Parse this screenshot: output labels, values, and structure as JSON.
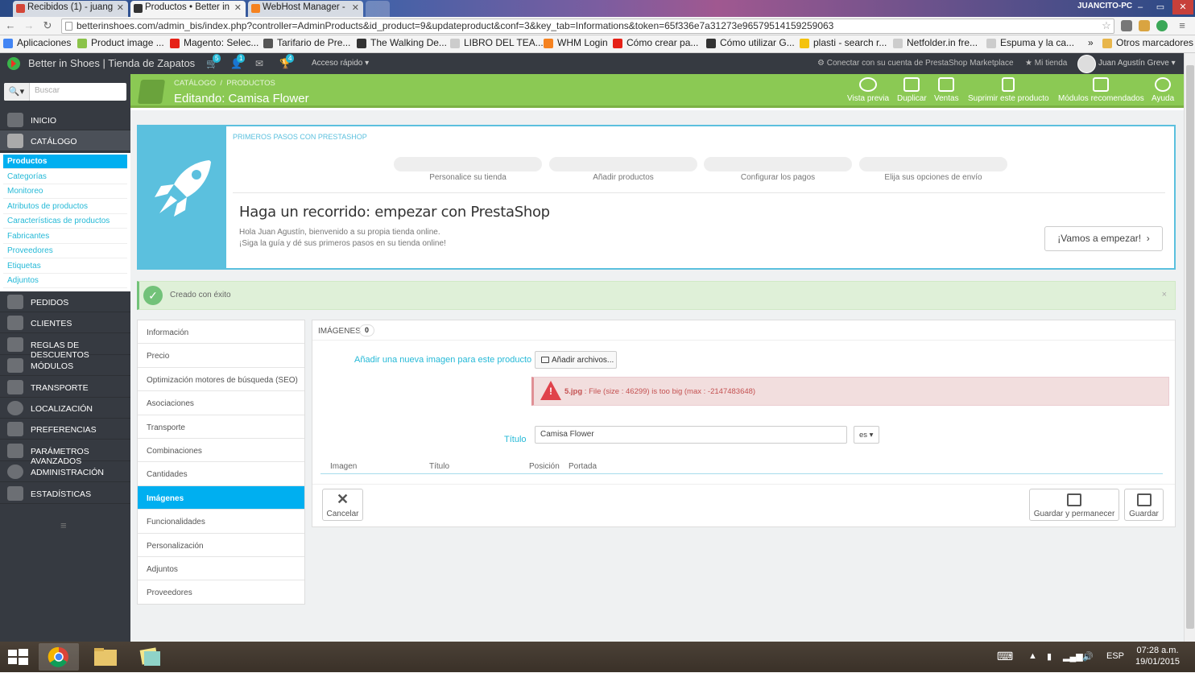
{
  "browser": {
    "tabs": [
      {
        "title": "Recibidos (1) - juang",
        "color": "#d44638"
      },
      {
        "title": "Productos • Better in",
        "color": "#333333"
      },
      {
        "title": "WebHost Manager -",
        "color": "#f58220"
      }
    ],
    "computer_name": "JUANCITO-PC",
    "url": "betterinshoes.com/admin_bis/index.php?controller=AdminProducts&id_product=9&updateproduct&conf=3&key_tab=Informations&token=65f336e7a31273e96579514159259063",
    "bookmarks": [
      {
        "label": "Aplicaciones",
        "color": "#4285f4"
      },
      {
        "label": "Product image ...",
        "color": "#8bc34a"
      },
      {
        "label": "Magento: Selec...",
        "color": "#e62117"
      },
      {
        "label": "Tarifario de Pre...",
        "color": "#555555"
      },
      {
        "label": "The Walking De...",
        "color": "#333333"
      },
      {
        "label": "LIBRO DEL TEA...",
        "color": "#cccccc"
      },
      {
        "label": "WHM Login",
        "color": "#f58220"
      },
      {
        "label": "Cómo crear pa...",
        "color": "#e62117"
      },
      {
        "label": "Cómo utilizar G...",
        "color": "#333333"
      },
      {
        "label": "plasti - search r...",
        "color": "#f4c20d"
      },
      {
        "label": "Netfolder.in fre...",
        "color": "#cccccc"
      },
      {
        "label": "Espuma y la ca...",
        "color": "#cccccc"
      },
      {
        "label": "»",
        "color": ""
      },
      {
        "label": "Otros marcadores",
        "color": "#e8b64c"
      }
    ]
  },
  "header": {
    "shop_name": "Better in Shoes | Tienda de Zapatos",
    "badges": {
      "orders": "5",
      "customers": "1",
      "trophies": "4"
    },
    "quick_access": "Acceso rápido",
    "connect": "Conectar con su cuenta de PrestaShop Marketplace",
    "my_shop": "Mi tienda",
    "user": "Juan Agustín Greve"
  },
  "sidebar": {
    "search_placeholder": "Buscar",
    "items": [
      {
        "label": "INICIO",
        "icon": "dashboard-icon"
      },
      {
        "label": "CATÁLOGO",
        "icon": "book-icon"
      },
      {
        "label": "PEDIDOS",
        "icon": "credit-card-icon"
      },
      {
        "label": "CLIENTES",
        "icon": "users-icon"
      },
      {
        "label": "REGLAS DE DESCUENTOS",
        "icon": "tags-icon"
      },
      {
        "label": "MÓDULOS",
        "icon": "puzzle-icon"
      },
      {
        "label": "TRANSPORTE",
        "icon": "truck-icon"
      },
      {
        "label": "LOCALIZACIÓN",
        "icon": "globe-icon"
      },
      {
        "label": "PREFERENCIAS",
        "icon": "wrench-icon"
      },
      {
        "label": "PARÁMETROS AVANZADOS",
        "icon": "cogs-icon"
      },
      {
        "label": "ADMINISTRACIÓN",
        "icon": "cog-icon"
      },
      {
        "label": "ESTADÍSTICAS",
        "icon": "bar-chart-icon"
      }
    ],
    "catalog_sub": [
      "Productos",
      "Categorías",
      "Monitoreo",
      "Atributos de productos",
      "Características de productos",
      "Fabricantes",
      "Proveedores",
      "Etiquetas",
      "Adjuntos"
    ]
  },
  "page_head": {
    "breadcrumb": [
      "CATÁLOGO",
      "/",
      "PRODUCTOS"
    ],
    "title": "Editando: Camisa Flower",
    "toolbar": [
      "Vista previa",
      "Duplicar",
      "Ventas",
      "Suprimir este producto",
      "Módulos recomendados",
      "Ayuda"
    ]
  },
  "onboarding": {
    "heading": "PRIMEROS PASOS CON PRESTASHOP",
    "steps": [
      "Personalice su tienda",
      "Añadir productos",
      "Configurar los pagos",
      "Elija sus opciones de envío"
    ],
    "title": "Haga un recorrido: empezar con PrestaShop",
    "line1": "Hola Juan Agustín, bienvenido a su propia tienda online.",
    "line2": "¡Siga la guía y dé sus primeros pasos en su tienda online!",
    "button": "¡Vamos a empezar!"
  },
  "alert": {
    "text": "Creado con éxito",
    "close": "×"
  },
  "product_tabs": {
    "items": [
      "Información",
      "Precio",
      "Optimización motores de búsqueda (SEO)",
      "Asociaciones",
      "Transporte",
      "Combinaciones",
      "Cantidades",
      "Imágenes",
      "Funcionalidades",
      "Personalización",
      "Adjuntos",
      "Proveedores"
    ],
    "active": "Imágenes"
  },
  "images_panel": {
    "heading": "IMÁGENES",
    "count": "0",
    "add_label": "Añadir una nueva imagen para este producto",
    "add_button": "Añadir archivos...",
    "error_file": "5.jpg",
    "error_text": " : File (size : 46299) is too big (max : -2147483648)",
    "title_label": "Título",
    "title_value": "Camisa Flower",
    "lang": "es",
    "columns": [
      "Imagen",
      "Título",
      "Posición",
      "Portada"
    ],
    "cancel": "Cancelar",
    "save_stay": "Guardar y permanecer",
    "save": "Guardar"
  },
  "taskbar": {
    "lang": "ESP",
    "time": "07:28 a.m.",
    "date": "19/01/2015"
  }
}
